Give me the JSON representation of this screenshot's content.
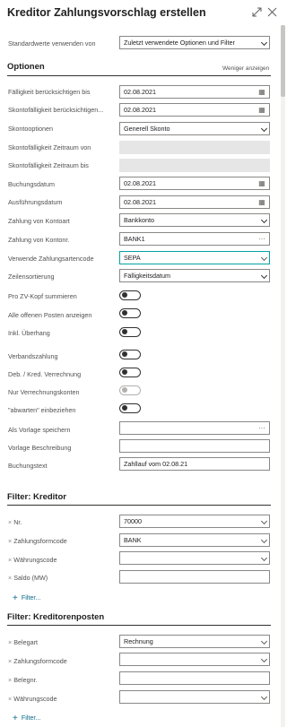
{
  "header": {
    "title": "Kreditor Zahlungsvorschlag erstellen"
  },
  "top": {
    "label": "Standardwerte verwenden von",
    "value": "Zuletzt verwendete Optionen und Filter"
  },
  "options": {
    "title": "Optionen",
    "less_link": "Weniger anzeigen",
    "faelligkeit": {
      "label": "Fälligkeit berücksichtigen bis",
      "value": "02.08.2021"
    },
    "skontofaelligkeit": {
      "label": "Skontofälligkeit berücksichtigen...",
      "value": "02.08.2021"
    },
    "skontooptionen": {
      "label": "Skontooptionen",
      "value": "Generell Skonto"
    },
    "skonto_von": {
      "label": "Skontofälligkeit Zeitraum von",
      "value": ""
    },
    "skonto_bis": {
      "label": "Skontofälligkeit Zeitraum bis",
      "value": ""
    },
    "buchungsdatum": {
      "label": "Buchungsdatum",
      "value": "02.08.2021"
    },
    "ausfuehrungsdatum": {
      "label": "Ausführungsdatum",
      "value": "02.08.2021"
    },
    "kontoart": {
      "label": "Zahlung von Kontoart",
      "value": "Bankkonto"
    },
    "kontonr": {
      "label": "Zahlung von Kontonr.",
      "value": "BANK1"
    },
    "zahlungsartencode": {
      "label": "Verwende Zahlungsartencode",
      "value": "SEPA"
    },
    "zeilensortierung": {
      "label": "Zeilensortierung",
      "value": "Fälligkeitsdatum"
    },
    "zv_kopf": {
      "label": "Pro ZV-Kopf summieren"
    },
    "offene_posten": {
      "label": "Alle offenen Posten anzeigen"
    },
    "ueberhang": {
      "label": "Inkl. Überhang"
    },
    "verbandszahlung": {
      "label": "Verbandszahlung"
    },
    "verrechnung": {
      "label": "Deb. / Kred. Verrechnung"
    },
    "nur_verrechnung": {
      "label": "Nur Verrechnungskonten"
    },
    "abwarten": {
      "label": "\"abwarten\" einbeziehen"
    },
    "vorlage_speichern": {
      "label": "Als Vorlage speichern",
      "value": ""
    },
    "vorlage_beschreibung": {
      "label": "Vorlage Beschreibung",
      "value": ""
    },
    "buchungstext": {
      "label": "Buchungstext",
      "value": "Zahllauf vom 02.08.21"
    }
  },
  "filter_kreditor": {
    "title": "Filter: Kreditor",
    "rows": [
      {
        "label": "Nr.",
        "value": "70000"
      },
      {
        "label": "Zahlungsformcode",
        "value": "BANK"
      },
      {
        "label": "Währungscode",
        "value": ""
      },
      {
        "label": "Saldo (MW)",
        "value": ""
      }
    ],
    "add_label": "Filter..."
  },
  "filter_posten": {
    "title": "Filter: Kreditorenposten",
    "rows": [
      {
        "label": "Belegart",
        "value": "Rechnung"
      },
      {
        "label": "Zahlungsformcode",
        "value": ""
      },
      {
        "label": "Belegnr.",
        "value": ""
      },
      {
        "label": "Währungscode",
        "value": ""
      }
    ],
    "add_label": "Filter..."
  },
  "colors": {
    "accent": "#00a3a3",
    "link": "#0b6a8a",
    "border": "#8a8886"
  }
}
